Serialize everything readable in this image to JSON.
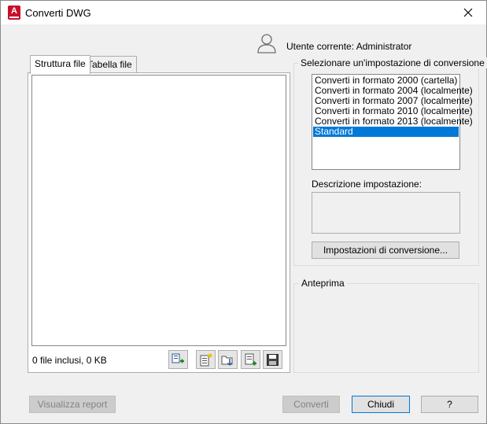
{
  "window": {
    "title": "Converti DWG",
    "app_icon_letter": "A"
  },
  "user": {
    "label": "Utente corrente: Administrator"
  },
  "tabs": [
    {
      "label": "Struttura file",
      "active": true
    },
    {
      "label": "Tabella file",
      "active": false
    }
  ],
  "files": {
    "count_label": "0 file inclusi, 0 KB"
  },
  "toolbar_icons": [
    "add-files-icon",
    "new-list-icon",
    "open-list-icon",
    "append-list-icon",
    "save-list-icon"
  ],
  "conversion": {
    "group_label": "Selezionare un'impostazione di conversione",
    "items": [
      "Converti in formato 2000 (cartella)",
      "Converti in formato 2004 (localmente)",
      "Converti in formato 2007 (localmente)",
      "Converti in formato 2010 (localmente)",
      "Converti in formato 2013 (localmente)",
      "Standard"
    ],
    "selected_index": 5,
    "description_label": "Descrizione impostazione:",
    "description_value": "",
    "settings_button": "Impostazioni di conversione..."
  },
  "preview": {
    "group_label": "Anteprima"
  },
  "buttons": {
    "report": "Visualizza report",
    "convert": "Converti",
    "close": "Chiudi",
    "help": "?"
  },
  "colors": {
    "selection": "#0078d7",
    "app_icon": "#c8102e"
  }
}
